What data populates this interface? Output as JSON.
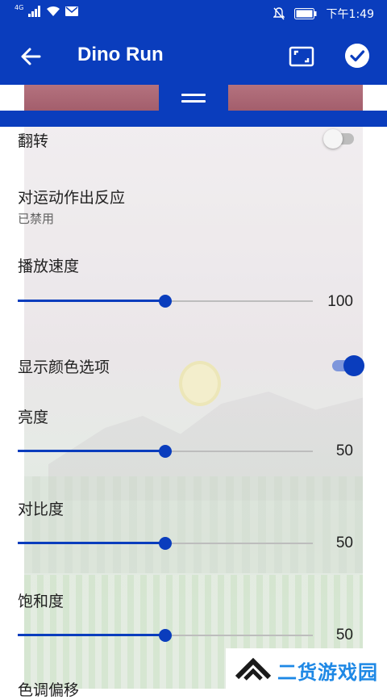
{
  "status_bar": {
    "network": "4G",
    "time": "下午1:49"
  },
  "app_bar": {
    "title": "Dino Run"
  },
  "settings": {
    "flip": {
      "label": "翻转",
      "enabled": false
    },
    "motion": {
      "label": "对运动作出反应",
      "subtitle": "已禁用"
    },
    "speed": {
      "label": "播放速度",
      "value": "100",
      "fraction": 0.5
    },
    "color_options": {
      "label": "显示颜色选项",
      "enabled": true
    },
    "brightness": {
      "label": "亮度",
      "value": "50",
      "fraction": 0.5
    },
    "contrast": {
      "label": "对比度",
      "value": "50",
      "fraction": 0.5
    },
    "saturation": {
      "label": "饱和度",
      "value": "50",
      "fraction": 0.5
    },
    "hue": {
      "label": "色调偏移"
    }
  },
  "watermark": {
    "text": "二货游戏园"
  },
  "colors": {
    "primary": "#0a3dbd",
    "accent_light": "#7e96db"
  }
}
